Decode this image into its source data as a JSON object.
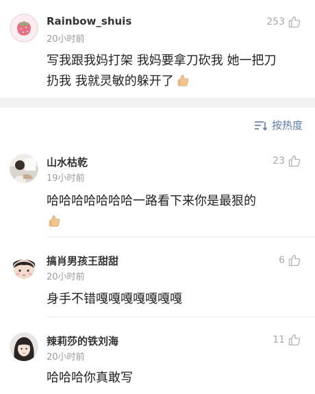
{
  "sort": {
    "label": "按热度",
    "icon": "sort-icon"
  },
  "comments": [
    {
      "user": "Rainbow_shuis",
      "time": "20小时前",
      "likes": "253",
      "line1": "写我跟我妈打架 我妈要拿刀砍我 她一把刀",
      "line2": "扔我 我就灵敏的躲开了",
      "emoji": "thumbs-up-emoji",
      "avatar": "strawberry-avatar"
    },
    {
      "user": "山水枯乾",
      "time": "19小时前",
      "likes": "23",
      "line1": "哈哈哈哈哈哈哈一路看下来你是最狠的",
      "line2": "",
      "emoji": "thumbs-up-emoji",
      "avatar": "person-photo-avatar"
    },
    {
      "user": "搞肖男孩王甜甜",
      "time": "20小时前",
      "likes": "6",
      "line1": "身手不错嘎嘎嘎嘎嘎嘎嘎",
      "avatar": "cartoon-boy-avatar"
    },
    {
      "user": "辣莉莎的铁刘海",
      "time": "20小时前",
      "likes": "11",
      "line1": "哈哈哈你真敢写",
      "avatar": "girl-photo-avatar"
    }
  ],
  "colors": {
    "like_icon": "#b0b0b0",
    "sort_text": "#5b7aa8",
    "separator": "#f2f2f2"
  }
}
